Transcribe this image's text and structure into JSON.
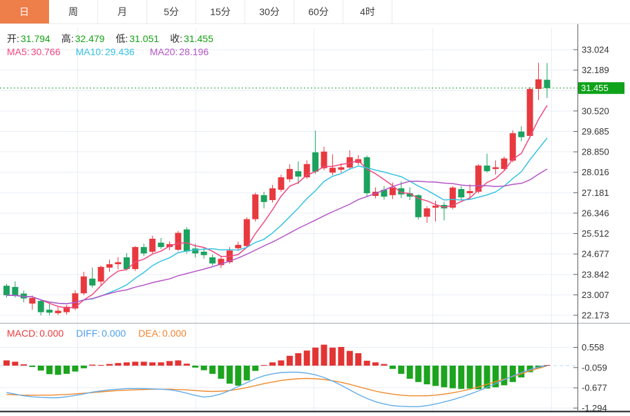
{
  "toolbar": {
    "tabs": [
      {
        "label": "日",
        "selected": true
      },
      {
        "label": "周",
        "selected": false
      },
      {
        "label": "月",
        "selected": false
      },
      {
        "label": "5分",
        "selected": false
      },
      {
        "label": "15分",
        "selected": false
      },
      {
        "label": "30分",
        "selected": false
      },
      {
        "label": "60分",
        "selected": false
      },
      {
        "label": "4时",
        "selected": false
      }
    ]
  },
  "info": {
    "ohlc": [
      {
        "label": "开:",
        "value": "31.794"
      },
      {
        "label": "高:",
        "value": "32.479"
      },
      {
        "label": "低:",
        "value": "31.051"
      },
      {
        "label": "收:",
        "value": "31.455"
      }
    ],
    "ma": [
      {
        "label": "MA5:",
        "value": "30.766",
        "color": "#F0487F"
      },
      {
        "label": "MA10:",
        "value": "29.436",
        "color": "#35C3E2"
      },
      {
        "label": "MA20:",
        "value": "28.196",
        "color": "#B455C8"
      }
    ],
    "macd": [
      {
        "label": "MACD:",
        "value": "0.000",
        "color": "#E83B3B"
      },
      {
        "label": "DIFF:",
        "value": "0.000",
        "color": "#4E9FE9"
      },
      {
        "label": "DEA:",
        "value": "0.000",
        "color": "#F08532"
      }
    ]
  },
  "price_axis": {
    "ticks": [
      "33.024",
      "32.189",
      "30.520",
      "29.685",
      "28.850",
      "28.016",
      "27.181",
      "26.346",
      "25.512",
      "24.677",
      "23.842",
      "23.007",
      "22.173"
    ],
    "current_tag": "31.455"
  },
  "macd_axis": {
    "ticks": [
      "0.558",
      "-0.059",
      "-0.677",
      "-1.294"
    ]
  },
  "colors": {
    "up": "#E8393F",
    "down": "#1CA25E",
    "macd_up": "#E33434",
    "macd_down": "#1CA41E",
    "ma5": "#F0487F",
    "ma10": "#35C3E2",
    "ma20": "#B455C8",
    "diff_line": "#64ACE8",
    "dea_line": "#EF8A2E",
    "ohlc_value": "#12A312",
    "price_tag_bg": "#0EA31B",
    "price_dotted_line": "#1FA32B",
    "zero_dashed_line": "#BDD9F2",
    "grid": "#E9EEF6",
    "tab_selected_bg": "#EE7E4A"
  },
  "chart_data": {
    "type": "candlestick",
    "note": "Daily candles, values read from price axis; arrays are [open,high,low,close]",
    "ma_periods": [
      5,
      10,
      20
    ],
    "current_price": 31.455,
    "price_axis_range": [
      22.173,
      33.024
    ],
    "macd_axis_range": [
      -1.294,
      0.558
    ],
    "candles": [
      [
        23.38,
        23.45,
        22.9,
        22.99
      ],
      [
        23.33,
        23.56,
        22.9,
        22.98
      ],
      [
        23.06,
        23.18,
        22.7,
        22.86
      ],
      [
        22.65,
        22.98,
        22.4,
        22.88
      ],
      [
        22.76,
        22.82,
        22.17,
        22.3
      ],
      [
        22.4,
        22.66,
        22.17,
        22.28
      ],
      [
        22.26,
        22.5,
        22.18,
        22.36
      ],
      [
        22.3,
        22.6,
        22.2,
        22.52
      ],
      [
        22.45,
        23.19,
        22.38,
        23.07
      ],
      [
        23.07,
        23.95,
        23.0,
        23.76
      ],
      [
        23.67,
        24.12,
        23.3,
        23.39
      ],
      [
        23.55,
        24.2,
        23.4,
        24.15
      ],
      [
        24.12,
        24.45,
        23.95,
        24.26
      ],
      [
        24.26,
        24.55,
        24.05,
        24.34
      ],
      [
        24.54,
        24.71,
        24.0,
        24.06
      ],
      [
        24.06,
        25.0,
        23.98,
        24.96
      ],
      [
        24.96,
        25.1,
        24.6,
        24.7
      ],
      [
        24.77,
        25.42,
        24.7,
        25.3
      ],
      [
        25.14,
        25.33,
        24.88,
        24.96
      ],
      [
        24.96,
        25.18,
        24.83,
        25.08
      ],
      [
        24.85,
        25.62,
        24.8,
        25.54
      ],
      [
        25.68,
        25.77,
        24.7,
        24.78
      ],
      [
        24.9,
        25.1,
        24.53,
        24.7
      ],
      [
        24.77,
        24.95,
        24.48,
        24.63
      ],
      [
        24.54,
        24.66,
        24.2,
        24.29
      ],
      [
        24.22,
        24.6,
        24.1,
        24.48
      ],
      [
        24.34,
        24.96,
        24.28,
        24.82
      ],
      [
        24.91,
        25.18,
        24.8,
        25.05
      ],
      [
        25.0,
        26.18,
        24.92,
        26.1
      ],
      [
        26.1,
        27.18,
        26.0,
        27.11
      ],
      [
        27.08,
        27.22,
        26.54,
        26.8
      ],
      [
        26.88,
        27.5,
        26.78,
        27.36
      ],
      [
        27.3,
        27.92,
        27.22,
        27.81
      ],
      [
        27.73,
        28.34,
        27.62,
        28.15
      ],
      [
        28.06,
        28.46,
        27.53,
        27.84
      ],
      [
        27.81,
        28.5,
        27.75,
        28.35
      ],
      [
        28.83,
        29.72,
        27.95,
        28.04
      ],
      [
        28.18,
        29.06,
        28.1,
        28.86
      ],
      [
        28.0,
        28.75,
        27.9,
        28.2
      ],
      [
        28.12,
        28.38,
        28.0,
        28.22
      ],
      [
        28.21,
        28.91,
        28.12,
        28.63
      ],
      [
        28.4,
        28.72,
        28.3,
        28.55
      ],
      [
        28.63,
        28.7,
        27.0,
        27.16
      ],
      [
        27.05,
        27.4,
        26.95,
        27.22
      ],
      [
        27.3,
        27.45,
        26.9,
        27.02
      ],
      [
        27.08,
        27.6,
        26.92,
        27.39
      ],
      [
        27.36,
        27.64,
        26.96,
        27.11
      ],
      [
        27.16,
        27.4,
        26.88,
        27.02
      ],
      [
        27.08,
        27.12,
        26.08,
        26.18
      ],
      [
        26.2,
        26.62,
        25.95,
        26.54
      ],
      [
        26.57,
        26.85,
        26.0,
        26.65
      ],
      [
        26.68,
        26.8,
        26.05,
        26.54
      ],
      [
        26.57,
        27.45,
        26.5,
        27.39
      ],
      [
        27.33,
        27.45,
        26.88,
        26.99
      ],
      [
        27.16,
        27.52,
        26.9,
        27.25
      ],
      [
        27.22,
        28.35,
        27.15,
        28.29
      ],
      [
        28.29,
        28.77,
        28.0,
        28.06
      ],
      [
        28.15,
        28.5,
        27.92,
        28.22
      ],
      [
        28.15,
        28.66,
        28.08,
        28.58
      ],
      [
        28.49,
        29.73,
        28.42,
        29.61
      ],
      [
        29.68,
        29.9,
        29.28,
        29.45
      ],
      [
        29.5,
        31.5,
        29.4,
        31.42
      ],
      [
        31.42,
        32.49,
        30.97,
        31.81
      ],
      [
        31.794,
        32.479,
        31.051,
        31.455
      ]
    ],
    "macd": {
      "histogram": [
        0.16,
        0.12,
        0.04,
        -0.04,
        -0.15,
        -0.26,
        -0.28,
        -0.25,
        -0.18,
        -0.08,
        0.03,
        0.02,
        0.05,
        0.08,
        0.1,
        0.12,
        0.12,
        0.1,
        0.1,
        0.14,
        0.16,
        0.06,
        -0.06,
        -0.14,
        -0.25,
        -0.4,
        -0.55,
        -0.61,
        -0.45,
        -0.16,
        0.02,
        0.1,
        0.16,
        0.3,
        0.38,
        0.46,
        0.55,
        0.64,
        0.55,
        0.57,
        0.45,
        0.38,
        0.15,
        0.1,
        0.05,
        -0.1,
        -0.25,
        -0.4,
        -0.5,
        -0.57,
        -0.62,
        -0.66,
        -0.69,
        -0.71,
        -0.7,
        -0.72,
        -0.7,
        -0.66,
        -0.6,
        -0.5,
        -0.36,
        -0.2,
        -0.08,
        0.01
      ],
      "diff": [
        -0.82,
        -0.87,
        -0.92,
        -0.95,
        -0.97,
        -0.98,
        -0.98,
        -0.95,
        -0.91,
        -0.86,
        -0.81,
        -0.77,
        -0.74,
        -0.72,
        -0.7,
        -0.7,
        -0.7,
        -0.71,
        -0.72,
        -0.74,
        -0.78,
        -0.84,
        -0.91,
        -0.96,
        -0.93,
        -0.86,
        -0.76,
        -0.64,
        -0.52,
        -0.4,
        -0.31,
        -0.25,
        -0.21,
        -0.2,
        -0.2,
        -0.23,
        -0.28,
        -0.36,
        -0.47,
        -0.6,
        -0.74,
        -0.88,
        -1.0,
        -1.1,
        -1.17,
        -1.22,
        -1.24,
        -1.25,
        -1.25,
        -1.22,
        -1.17,
        -1.11,
        -1.04,
        -0.96,
        -0.87,
        -0.77,
        -0.66,
        -0.55,
        -0.43,
        -0.32,
        -0.21,
        -0.12,
        -0.04,
        0.0
      ],
      "dea": [
        -0.88,
        -0.89,
        -0.9,
        -0.9,
        -0.9,
        -0.9,
        -0.89,
        -0.88,
        -0.86,
        -0.84,
        -0.82,
        -0.8,
        -0.78,
        -0.76,
        -0.75,
        -0.74,
        -0.73,
        -0.72,
        -0.72,
        -0.72,
        -0.73,
        -0.74,
        -0.76,
        -0.78,
        -0.79,
        -0.78,
        -0.76,
        -0.72,
        -0.67,
        -0.61,
        -0.55,
        -0.5,
        -0.45,
        -0.42,
        -0.4,
        -0.39,
        -0.4,
        -0.42,
        -0.46,
        -0.51,
        -0.57,
        -0.64,
        -0.71,
        -0.78,
        -0.83,
        -0.87,
        -0.9,
        -0.92,
        -0.92,
        -0.92,
        -0.9,
        -0.87,
        -0.83,
        -0.78,
        -0.72,
        -0.65,
        -0.57,
        -0.49,
        -0.41,
        -0.33,
        -0.25,
        -0.16,
        -0.08,
        -0.01
      ]
    }
  }
}
